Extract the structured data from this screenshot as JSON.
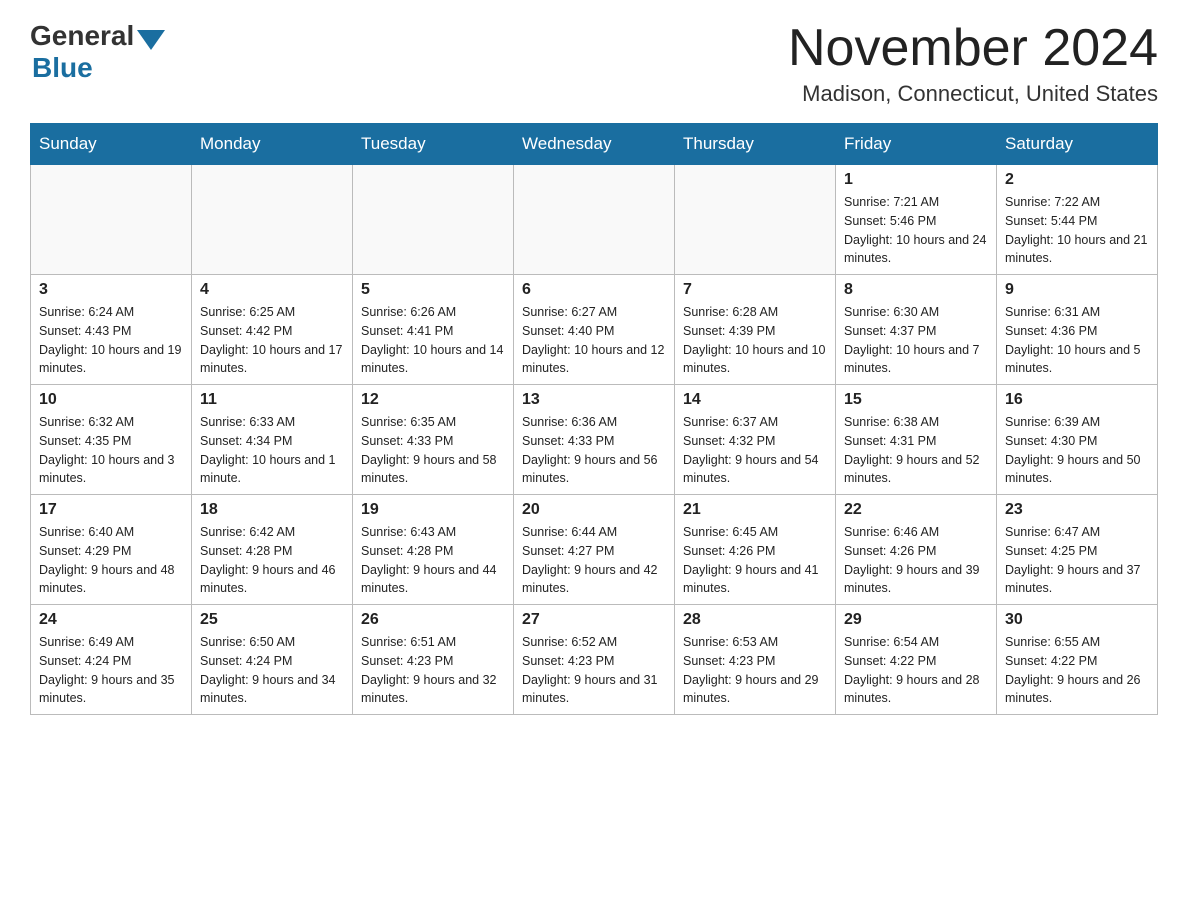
{
  "header": {
    "logo_general": "General",
    "logo_blue": "Blue",
    "month_title": "November 2024",
    "location": "Madison, Connecticut, United States"
  },
  "days_of_week": [
    "Sunday",
    "Monday",
    "Tuesday",
    "Wednesday",
    "Thursday",
    "Friday",
    "Saturday"
  ],
  "weeks": [
    [
      {
        "day": "",
        "info": ""
      },
      {
        "day": "",
        "info": ""
      },
      {
        "day": "",
        "info": ""
      },
      {
        "day": "",
        "info": ""
      },
      {
        "day": "",
        "info": ""
      },
      {
        "day": "1",
        "info": "Sunrise: 7:21 AM\nSunset: 5:46 PM\nDaylight: 10 hours and 24 minutes."
      },
      {
        "day": "2",
        "info": "Sunrise: 7:22 AM\nSunset: 5:44 PM\nDaylight: 10 hours and 21 minutes."
      }
    ],
    [
      {
        "day": "3",
        "info": "Sunrise: 6:24 AM\nSunset: 4:43 PM\nDaylight: 10 hours and 19 minutes."
      },
      {
        "day": "4",
        "info": "Sunrise: 6:25 AM\nSunset: 4:42 PM\nDaylight: 10 hours and 17 minutes."
      },
      {
        "day": "5",
        "info": "Sunrise: 6:26 AM\nSunset: 4:41 PM\nDaylight: 10 hours and 14 minutes."
      },
      {
        "day": "6",
        "info": "Sunrise: 6:27 AM\nSunset: 4:40 PM\nDaylight: 10 hours and 12 minutes."
      },
      {
        "day": "7",
        "info": "Sunrise: 6:28 AM\nSunset: 4:39 PM\nDaylight: 10 hours and 10 minutes."
      },
      {
        "day": "8",
        "info": "Sunrise: 6:30 AM\nSunset: 4:37 PM\nDaylight: 10 hours and 7 minutes."
      },
      {
        "day": "9",
        "info": "Sunrise: 6:31 AM\nSunset: 4:36 PM\nDaylight: 10 hours and 5 minutes."
      }
    ],
    [
      {
        "day": "10",
        "info": "Sunrise: 6:32 AM\nSunset: 4:35 PM\nDaylight: 10 hours and 3 minutes."
      },
      {
        "day": "11",
        "info": "Sunrise: 6:33 AM\nSunset: 4:34 PM\nDaylight: 10 hours and 1 minute."
      },
      {
        "day": "12",
        "info": "Sunrise: 6:35 AM\nSunset: 4:33 PM\nDaylight: 9 hours and 58 minutes."
      },
      {
        "day": "13",
        "info": "Sunrise: 6:36 AM\nSunset: 4:33 PM\nDaylight: 9 hours and 56 minutes."
      },
      {
        "day": "14",
        "info": "Sunrise: 6:37 AM\nSunset: 4:32 PM\nDaylight: 9 hours and 54 minutes."
      },
      {
        "day": "15",
        "info": "Sunrise: 6:38 AM\nSunset: 4:31 PM\nDaylight: 9 hours and 52 minutes."
      },
      {
        "day": "16",
        "info": "Sunrise: 6:39 AM\nSunset: 4:30 PM\nDaylight: 9 hours and 50 minutes."
      }
    ],
    [
      {
        "day": "17",
        "info": "Sunrise: 6:40 AM\nSunset: 4:29 PM\nDaylight: 9 hours and 48 minutes."
      },
      {
        "day": "18",
        "info": "Sunrise: 6:42 AM\nSunset: 4:28 PM\nDaylight: 9 hours and 46 minutes."
      },
      {
        "day": "19",
        "info": "Sunrise: 6:43 AM\nSunset: 4:28 PM\nDaylight: 9 hours and 44 minutes."
      },
      {
        "day": "20",
        "info": "Sunrise: 6:44 AM\nSunset: 4:27 PM\nDaylight: 9 hours and 42 minutes."
      },
      {
        "day": "21",
        "info": "Sunrise: 6:45 AM\nSunset: 4:26 PM\nDaylight: 9 hours and 41 minutes."
      },
      {
        "day": "22",
        "info": "Sunrise: 6:46 AM\nSunset: 4:26 PM\nDaylight: 9 hours and 39 minutes."
      },
      {
        "day": "23",
        "info": "Sunrise: 6:47 AM\nSunset: 4:25 PM\nDaylight: 9 hours and 37 minutes."
      }
    ],
    [
      {
        "day": "24",
        "info": "Sunrise: 6:49 AM\nSunset: 4:24 PM\nDaylight: 9 hours and 35 minutes."
      },
      {
        "day": "25",
        "info": "Sunrise: 6:50 AM\nSunset: 4:24 PM\nDaylight: 9 hours and 34 minutes."
      },
      {
        "day": "26",
        "info": "Sunrise: 6:51 AM\nSunset: 4:23 PM\nDaylight: 9 hours and 32 minutes."
      },
      {
        "day": "27",
        "info": "Sunrise: 6:52 AM\nSunset: 4:23 PM\nDaylight: 9 hours and 31 minutes."
      },
      {
        "day": "28",
        "info": "Sunrise: 6:53 AM\nSunset: 4:23 PM\nDaylight: 9 hours and 29 minutes."
      },
      {
        "day": "29",
        "info": "Sunrise: 6:54 AM\nSunset: 4:22 PM\nDaylight: 9 hours and 28 minutes."
      },
      {
        "day": "30",
        "info": "Sunrise: 6:55 AM\nSunset: 4:22 PM\nDaylight: 9 hours and 26 minutes."
      }
    ]
  ]
}
